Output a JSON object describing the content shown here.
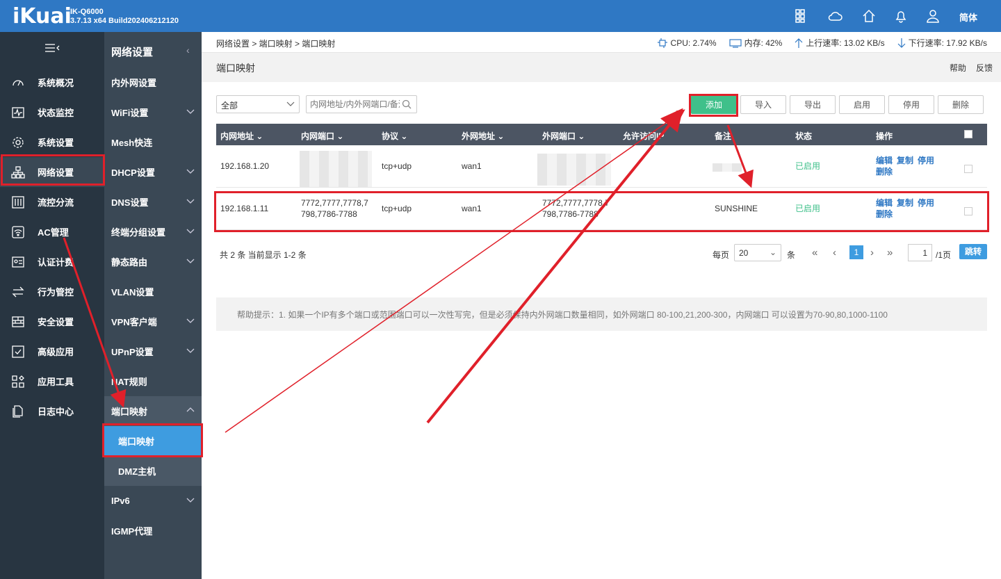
{
  "header": {
    "logo": "iKuai",
    "model": "IK-Q6000",
    "build": "3.7.13 x64 Build202406212120",
    "lang": "简体",
    "icons": [
      "apps-icon",
      "cloud-icon",
      "home-icon",
      "bell-icon",
      "user-icon"
    ]
  },
  "sidebar": {
    "items": [
      {
        "label": "系统概况",
        "icon": "dashboard-icon"
      },
      {
        "label": "状态监控",
        "icon": "pulse-icon"
      },
      {
        "label": "系统设置",
        "icon": "gear-icon"
      },
      {
        "label": "网络设置",
        "icon": "network-icon"
      },
      {
        "label": "流控分流",
        "icon": "sliders-icon"
      },
      {
        "label": "AC管理",
        "icon": "wifi-icon"
      },
      {
        "label": "认证计费",
        "icon": "id-card-icon"
      },
      {
        "label": "行为管控",
        "icon": "arrows-icon"
      },
      {
        "label": "安全设置",
        "icon": "firewall-icon"
      },
      {
        "label": "高级应用",
        "icon": "check-icon"
      },
      {
        "label": "应用工具",
        "icon": "tools-icon"
      },
      {
        "label": "日志中心",
        "icon": "docs-icon"
      }
    ]
  },
  "subbar": {
    "title": "网络设置",
    "items": [
      "内外网设置",
      "WiFi设置",
      "Mesh快连",
      "DHCP设置",
      "DNS设置",
      "终端分组设置",
      "静态路由",
      "VLAN设置",
      "VPN客户端",
      "UPnP设置",
      "NAT规则",
      "端口映射",
      "端口映射",
      "DMZ主机",
      "IPv6",
      "IGMP代理"
    ]
  },
  "crumb": "网络设置 > 端口映射 > 端口映射",
  "stats": {
    "cpu": "CPU: 2.74%",
    "mem": "内存: 42%",
    "up": "上行速率: 13.02 KB/s",
    "down": "下行速率: 17.92 KB/s"
  },
  "page": {
    "title": "端口映射",
    "help": "帮助",
    "feedback": "反馈"
  },
  "toolbar": {
    "filter": "全部",
    "search_placeholder": "内网地址/内外网端口/备注",
    "add": "添加",
    "import": "导入",
    "export": "导出",
    "enable": "启用",
    "disable": "停用",
    "delete": "删除"
  },
  "table": {
    "headers": [
      "内网地址",
      "内网端口",
      "协议",
      "外网地址",
      "外网端口",
      "允许访问IP",
      "备注",
      "状态",
      "操作"
    ],
    "rows": [
      {
        "ip": "192.168.1.20",
        "lan_port": "",
        "proto": "tcp+udp",
        "wan": "wan1",
        "wan_port": "",
        "allow": "",
        "note": "",
        "status": "已启用"
      },
      {
        "ip": "192.168.1.11",
        "lan_port_1": "7772,7777,7778,7",
        "lan_port_2": "798,7786-7788",
        "proto": "tcp+udp",
        "wan": "wan1",
        "wan_port_1": "7772,7777,7778,7",
        "wan_port_2": "798,7786-7788",
        "allow": "",
        "note": "SUNSHINE",
        "status": "已启用"
      }
    ],
    "ops": {
      "edit": "编辑",
      "copy": "复制",
      "disable": "停用",
      "delete": "删除"
    }
  },
  "pager": {
    "summary": "共 2 条 当前显示 1-2 条",
    "per_page_label": "每页",
    "per_page": "20",
    "unit": "条",
    "current": "1",
    "input": "1",
    "total_pages": "/1页",
    "go": "跳转"
  },
  "hint": "帮助提示：1. 如果一个IP有多个端口或范围端口可以一次性写完，但是必须保持内外网端口数量相同，如外网端口 80-100,21,200-300，内网端口 可以设置为70-90,80,1000-1100",
  "colors": {
    "primary": "#2f78c4",
    "sidebar": "#283541",
    "subbar": "#3a4855",
    "add": "#3fc08a",
    "annotation": "#e0202a"
  }
}
